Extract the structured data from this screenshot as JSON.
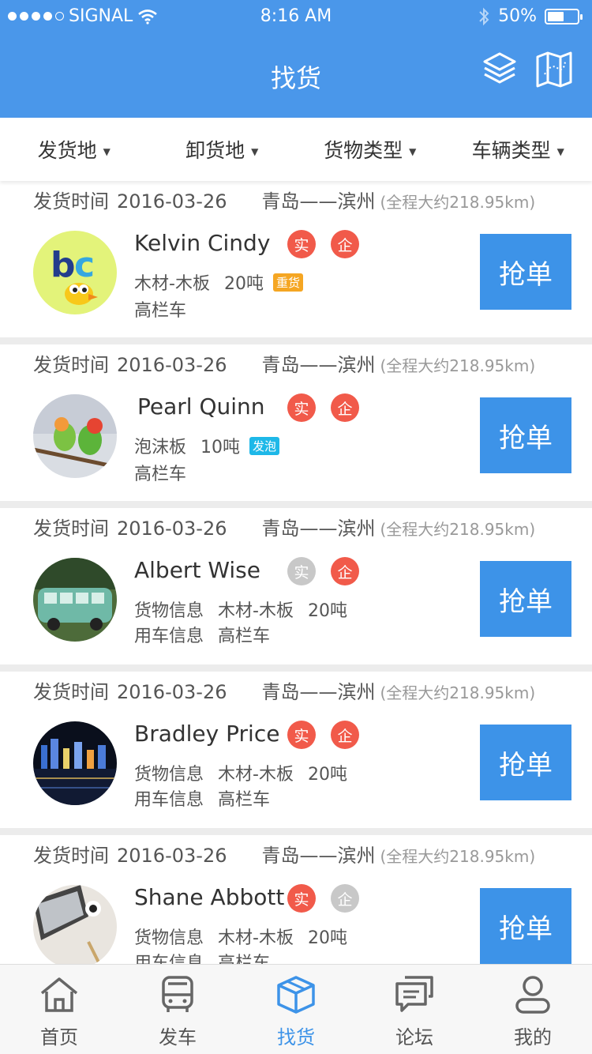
{
  "status_bar": {
    "carrier": "SIGNAL",
    "time": "8:16 AM",
    "battery": "50%"
  },
  "header": {
    "title": "找货"
  },
  "filters": [
    {
      "label": "发货地"
    },
    {
      "label": "卸货地"
    },
    {
      "label": "货物类型"
    },
    {
      "label": "车辆类型"
    }
  ],
  "common": {
    "ship_time_label": "发货时间",
    "grab_label": "抢单",
    "cargo_info_label": "货物信息",
    "vehicle_info_label": "用车信息"
  },
  "orders": [
    {
      "date": "2016-03-26",
      "route": "青岛——滨州",
      "distance": "(全程大约218.95km)",
      "name": "Kelvin Cindy",
      "badge1": "实",
      "badge2": "企",
      "cargo": "木材-木板",
      "weight": "20吨",
      "tag": "重货",
      "vehicle": "高栏车"
    },
    {
      "date": "2016-03-26",
      "route": "青岛——滨州",
      "distance": "(全程大约218.95km)",
      "name": "Pearl Quinn",
      "badge1": "实",
      "badge2": "企",
      "cargo": "泡沫板",
      "weight": "10吨",
      "tag": "发泡",
      "vehicle": "高栏车"
    },
    {
      "date": "2016-03-26",
      "route": "青岛——滨州",
      "distance": "(全程大约218.95km)",
      "name": "Albert Wise",
      "badge1": "实",
      "badge2": "企",
      "cargo": "木材-木板",
      "weight": "20吨",
      "vehicle": "高栏车"
    },
    {
      "date": "2016-03-26",
      "route": "青岛——滨州",
      "distance": "(全程大约218.95km)",
      "name": "Bradley Price",
      "badge1": "实",
      "badge2": "企",
      "cargo": "木材-木板",
      "weight": "20吨",
      "vehicle": "高栏车"
    },
    {
      "date": "2016-03-26",
      "route": "青岛——滨州",
      "distance": "(全程大约218.95km)",
      "name": "Shane Abbott",
      "badge1": "实",
      "badge2": "企",
      "cargo": "木材-木板",
      "weight": "20吨",
      "vehicle": "高栏车"
    }
  ],
  "tabbar": [
    {
      "label": "首页",
      "icon": "home-icon"
    },
    {
      "label": "发车",
      "icon": "bus-icon"
    },
    {
      "label": "找货",
      "icon": "box-icon"
    },
    {
      "label": "论坛",
      "icon": "chat-icon"
    },
    {
      "label": "我的",
      "icon": "user-icon"
    }
  ],
  "colors": {
    "primary": "#4a97ea",
    "badge_red": "#f15a4a",
    "badge_gray": "#c8c8c8",
    "tag_orange": "#f5a623",
    "tag_blue": "#1eb8e8"
  }
}
